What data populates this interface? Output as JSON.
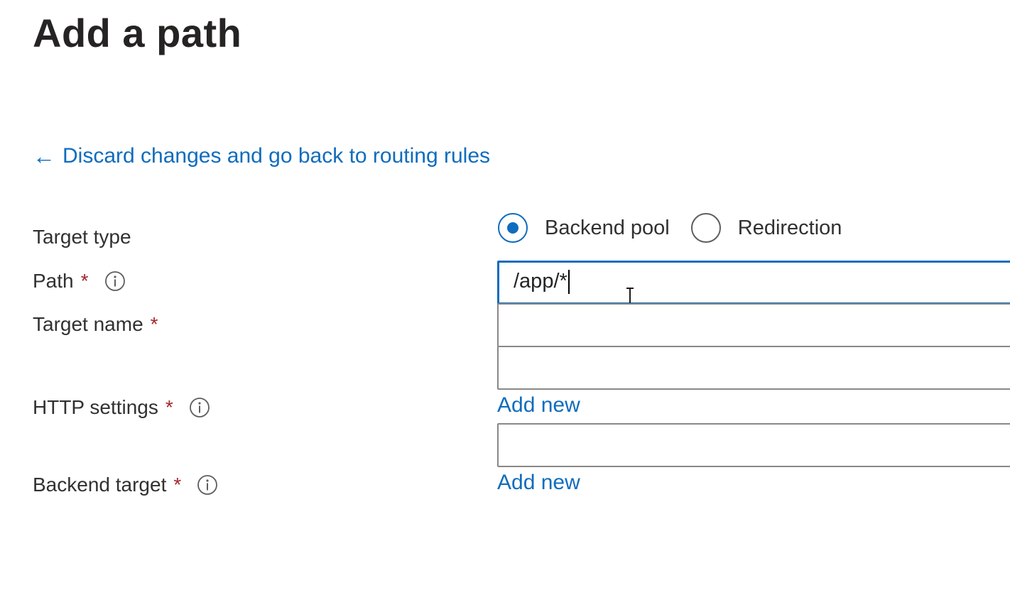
{
  "page": {
    "title": "Add a path"
  },
  "back_link": {
    "arrow_icon": "left-arrow-icon",
    "label": "Discard changes and go back to routing rules"
  },
  "form": {
    "target_type": {
      "label": "Target type",
      "options": [
        {
          "label": "Backend pool",
          "selected": true
        },
        {
          "label": "Redirection",
          "selected": false
        }
      ]
    },
    "path": {
      "label": "Path",
      "required": "*",
      "info_icon": "info-icon",
      "value": "/app/*"
    },
    "target_name": {
      "label": "Target name",
      "required": "*",
      "value": ""
    },
    "http_settings": {
      "label": "HTTP settings",
      "required": "*",
      "info_icon": "info-icon",
      "value": "",
      "add_new": "Add new"
    },
    "backend_target": {
      "label": "Backend target",
      "required": "*",
      "info_icon": "info-icon",
      "value": "",
      "add_new": "Add new"
    }
  },
  "colors": {
    "accent": "#0f6cbd",
    "required": "#a4262c",
    "text": "#323130",
    "border": "#8a8886"
  }
}
